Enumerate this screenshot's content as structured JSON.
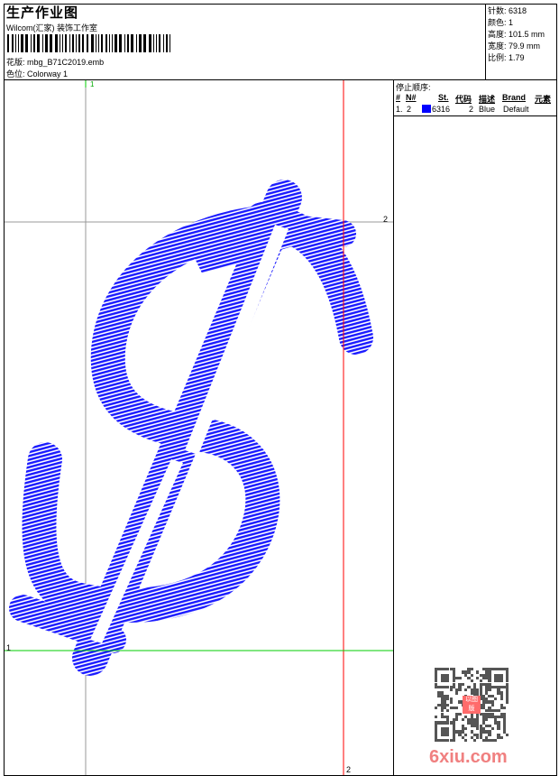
{
  "header": {
    "title": "生产作业图",
    "company": "Wilcom(汇家) 装饰工作室",
    "design_label": "花版:",
    "design_value": "mbg_B71C2019.emb",
    "colorway_label": "色位:",
    "colorway_value": "Colorway 1"
  },
  "info": {
    "stitches_label": "针数:",
    "stitches": "6318",
    "colors_label": "颜色:",
    "colors": "1",
    "height_label": "高度:",
    "height": "101.5 mm",
    "width_label": "宽度:",
    "width": "79.9 mm",
    "scale_label": "比例:",
    "scale": "1.79"
  },
  "stop_sequence": {
    "title": "停止顺序:",
    "columns": [
      "#",
      "N#",
      "St.",
      "代码",
      "描述",
      "Brand",
      "元素"
    ],
    "rows": [
      {
        "index": "1.",
        "n": "2",
        "color": "#0000ff",
        "stitches": "6316",
        "code": "2",
        "desc": "Blue",
        "brand": "Default"
      }
    ]
  },
  "canvas": {
    "markers": [
      "1",
      "2",
      "1",
      "2"
    ],
    "thread_color": "#1a1aff"
  },
  "watermark": {
    "stamp": "以图版",
    "site": "6xiu.com"
  }
}
